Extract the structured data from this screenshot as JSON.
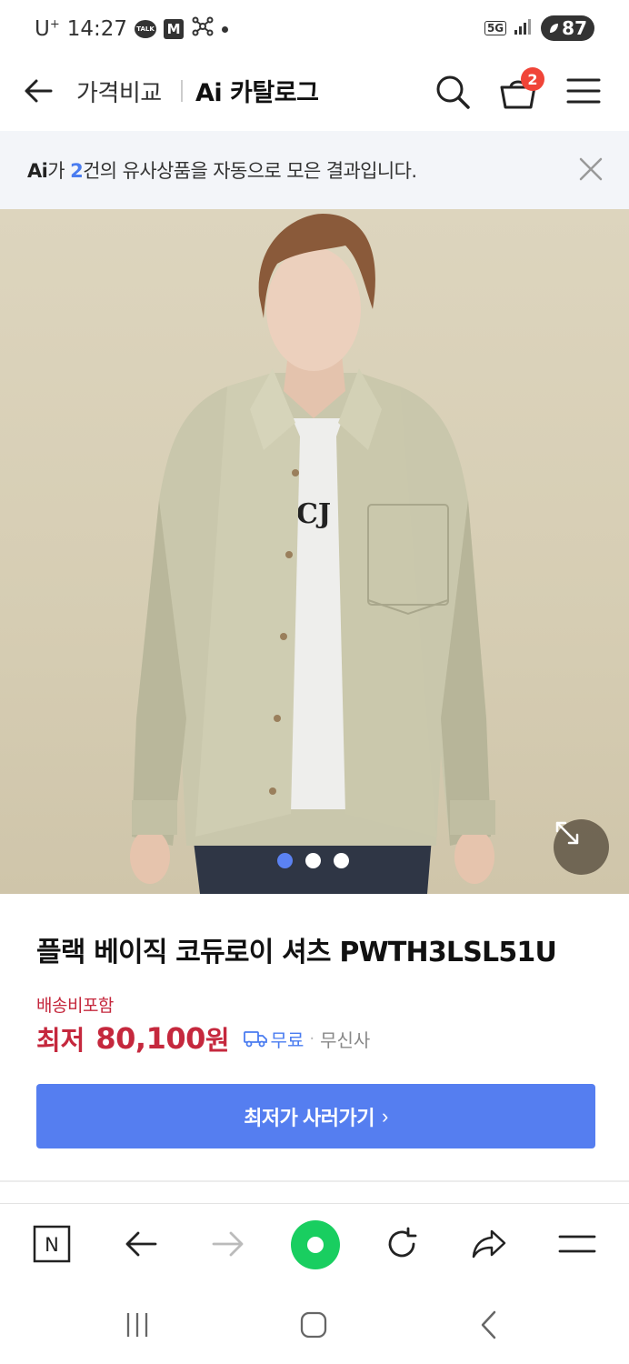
{
  "status_bar": {
    "carrier": "U",
    "carrier_sup": "+",
    "time": "14:27",
    "talk_badge": "TALK",
    "m_badge": "M",
    "network": "5G",
    "battery": "87"
  },
  "header": {
    "title_primary": "가격비교",
    "title_secondary": "Ai 카탈로그",
    "cart_count": "2"
  },
  "banner": {
    "prefix": "Ai",
    "mid1": "가 ",
    "count": "2",
    "suffix": "건의 유사상품을 자동으로 모은 결과입니다."
  },
  "product": {
    "image_pager": {
      "total": 3,
      "current": 1
    },
    "title": "플랙 베이직 코듀로이 셔츠 PWTH3LSL51U",
    "shipping_label": "배송비포함",
    "price_prefix": "최저",
    "price_value": "80,100",
    "price_unit": "원",
    "shipping_fee": "무료",
    "separator": "·",
    "seller": "무신사",
    "cta_label": "최저가 사러가기",
    "cta_chevron": "›"
  },
  "colors": {
    "accent_blue": "#557ef0",
    "price_red": "#c5283d",
    "home_green": "#19ce60",
    "badge_red": "#f04438"
  },
  "toolbar": {
    "icons": [
      "naver-n-icon",
      "back-arrow-icon",
      "forward-arrow-icon",
      "home-green-icon",
      "refresh-icon",
      "share-icon",
      "menu-icon"
    ],
    "naver_letter": "N"
  },
  "navbar": {
    "icons": [
      "recent-apps-icon",
      "home-icon",
      "back-icon"
    ]
  }
}
